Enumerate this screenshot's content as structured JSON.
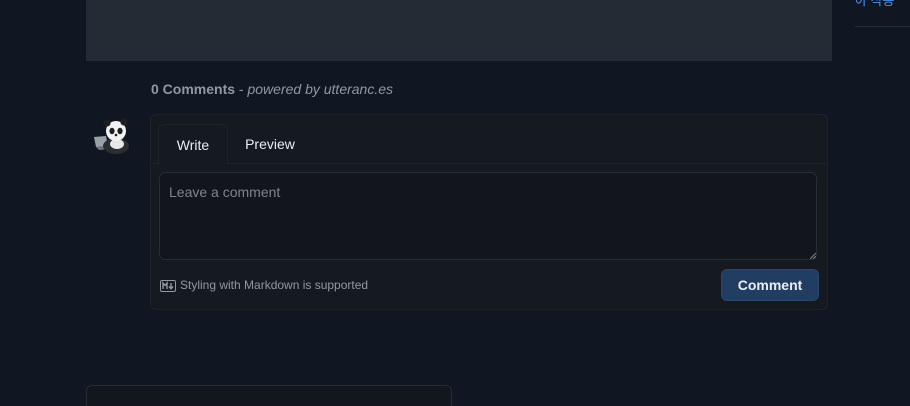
{
  "sidebar": {
    "toc_link_label": "아 작동"
  },
  "comments": {
    "count_label": "0 Comments",
    "separator": " - ",
    "powered_by": "powered by utteranc.es"
  },
  "editor": {
    "tabs": [
      {
        "label": "Write"
      },
      {
        "label": "Preview"
      }
    ],
    "placeholder": "Leave a comment",
    "value": "",
    "markdown_hint": "Styling with Markdown is supported",
    "submit_label": "Comment"
  },
  "icons": {
    "avatar": "panda-avatar-icon",
    "markdown": "markdown-icon",
    "resize": "resize-grip-icon"
  },
  "colors": {
    "background": "#111722",
    "panel": "#151a21",
    "accent_button": "#223d62",
    "link": "#4493f8",
    "muted_text": "#9198a1"
  }
}
